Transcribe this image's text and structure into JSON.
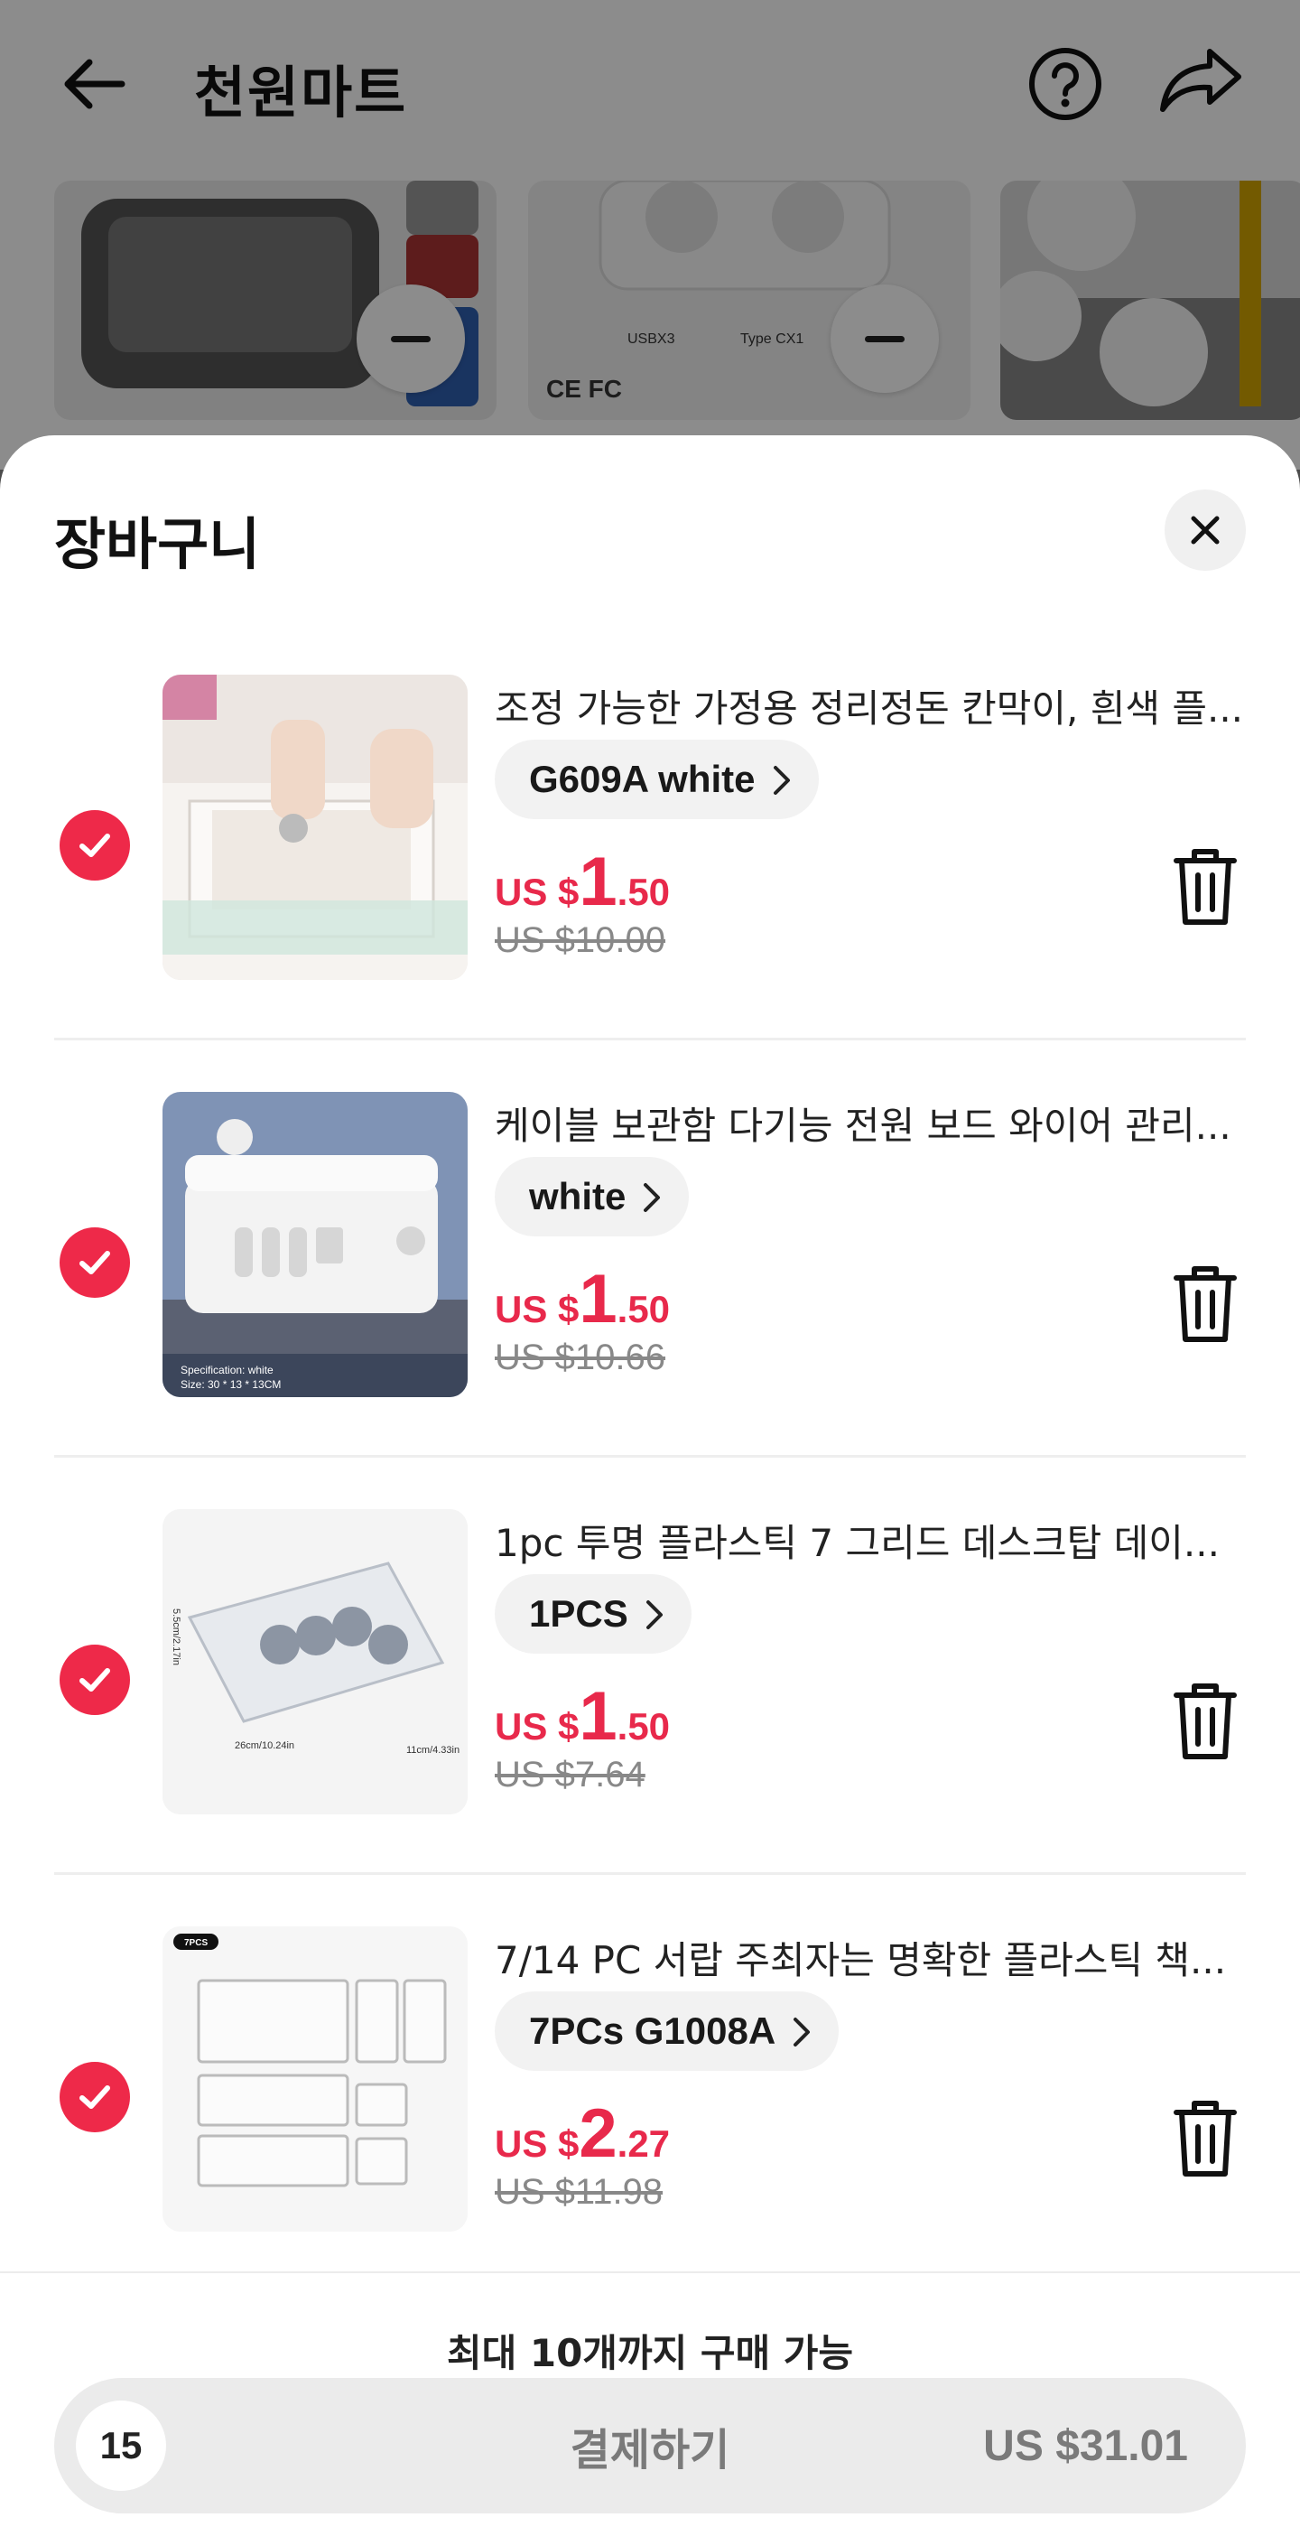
{
  "background": {
    "title": "천원마트"
  },
  "sheet": {
    "title": "장바구니"
  },
  "items": [
    {
      "name": "조정 가능한 가정용 정리정돈 칸막이, 흰색 플...",
      "variant": "G609A white",
      "price_currency": "US $",
      "price_whole": "1",
      "price_fraction": ".50",
      "original_price": "US $10.00",
      "checked": true
    },
    {
      "name": "케이블 보관함 다기능 전원 보드 와이어 관리...",
      "variant": "white",
      "price_currency": "US $",
      "price_whole": "1",
      "price_fraction": ".50",
      "original_price": "US $10.66",
      "checked": true,
      "image_caption_1": "Specification: white",
      "image_caption_2": "Size: 30 * 13 * 13CM"
    },
    {
      "name": "1pc 투명 플라스틱 7 그리드 데스크탑 데이...",
      "variant": "1PCS",
      "price_currency": "US $",
      "price_whole": "1",
      "price_fraction": ".50",
      "original_price": "US $7.64",
      "checked": true,
      "image_dim_1": "26cm/10.24in",
      "image_dim_2": "11cm/4.33in",
      "image_dim_3": "5.5cm/2.17in"
    },
    {
      "name": "7/14 PC 서랍 주최자는 명확한 플라스틱 책...",
      "variant": "7PCs G1008A",
      "price_currency": "US $",
      "price_whole": "2",
      "price_fraction": ".27",
      "original_price": "US $11.98",
      "checked": true,
      "image_badge": "7PCS"
    }
  ],
  "footer": {
    "limit_text": "최대 10개까지 구매 가능",
    "quantity": "15",
    "checkout_label": "결제하기",
    "total": "US $31.01"
  },
  "colors": {
    "accent": "#ee2949",
    "price": "#e8294b"
  }
}
